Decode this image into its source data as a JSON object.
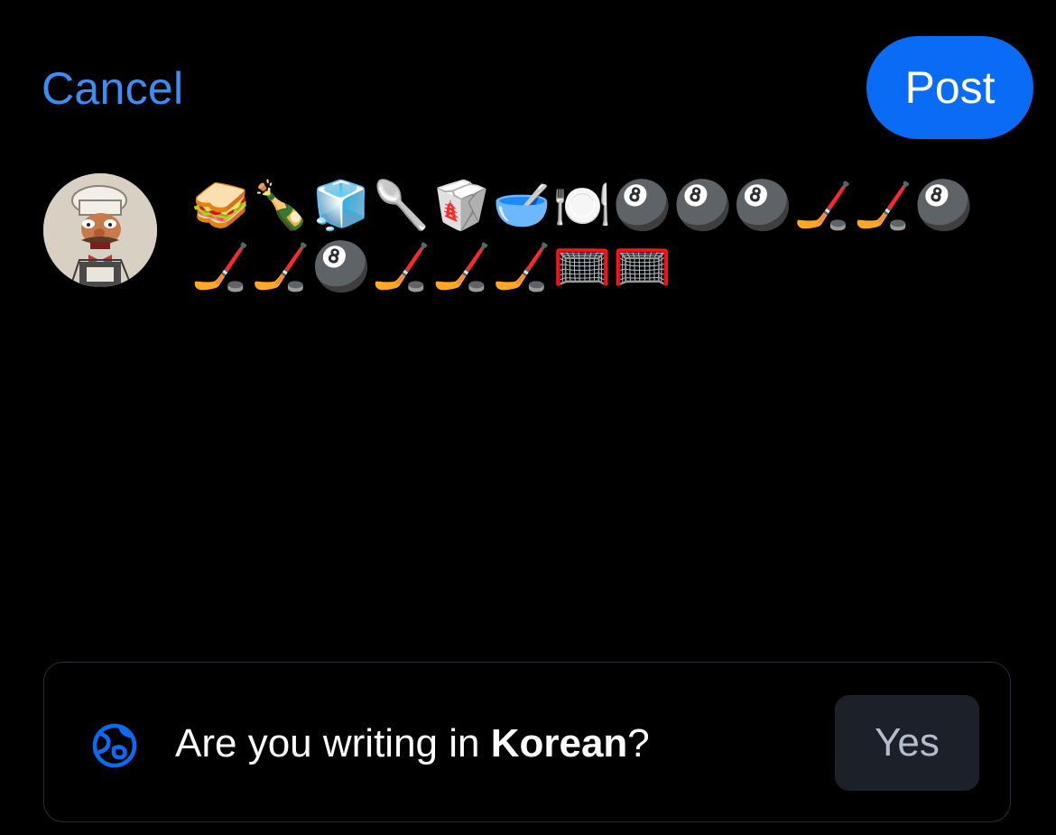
{
  "header": {
    "cancel_label": "Cancel",
    "post_label": "Post"
  },
  "composer": {
    "avatar_icon": "chef-avatar",
    "post_text": "🥪🍾🧊🥄🥡🥣🍽️🎱🎱🎱🏒🏒🎱🏒🏒🎱🏒🏒🏒🥅🥅"
  },
  "language_prompt": {
    "icon": "globe-icon",
    "question_prefix": "Are you writing in ",
    "language": "Korean",
    "question_suffix": "?",
    "yes_label": "Yes"
  },
  "colors": {
    "background": "#000000",
    "accent": "#0a6cf5",
    "cancel_text": "#3a8ef6",
    "yes_button_bg": "#1b2029",
    "yes_button_text": "#b3bdcc",
    "card_border": "#2a2d3a"
  }
}
